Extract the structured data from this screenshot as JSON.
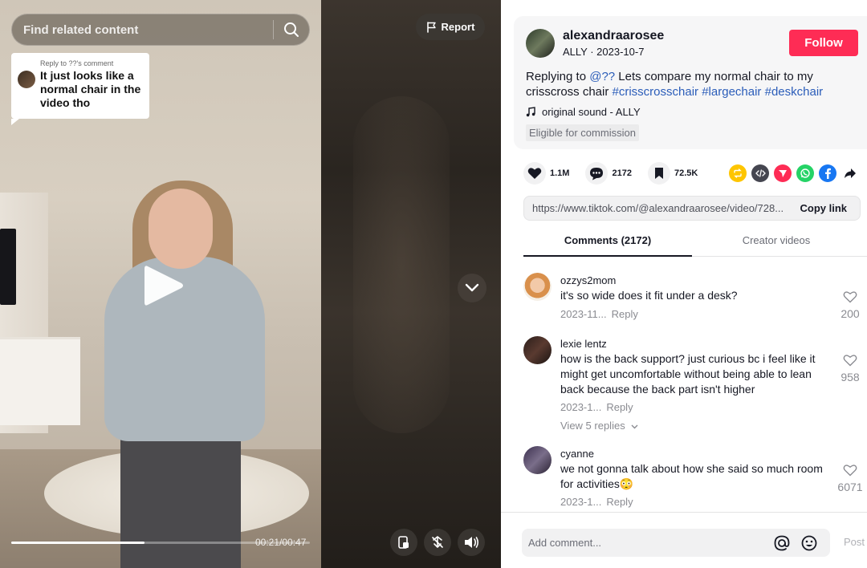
{
  "video": {
    "search_placeholder": "Find related content",
    "reply_header": "Reply to ??'s comment",
    "reply_text": "It just looks like a normal chair in the video tho",
    "report_label": "Report",
    "time": "00:21/00:47",
    "progress": 0.447
  },
  "post": {
    "author": "alexandraarosee",
    "nickname_date": "ALLY · 2023-10-7",
    "follow_label": "Follow",
    "desc_prefix": "Replying to ",
    "mention": "@??",
    "desc_text": " Lets compare my normal chair to my crisscross chair ",
    "hashtags": [
      "#crisscrosschair",
      "#largechair",
      "#deskchair"
    ],
    "sound": "original sound - ALLY",
    "commission": "Eligible for commission"
  },
  "stats": {
    "likes": "1.1M",
    "comments": "2172",
    "saves": "72.5K"
  },
  "share_icons": [
    "repost-icon",
    "embed-icon",
    "send-icon",
    "whatsapp-icon",
    "facebook-icon",
    "share-arrow-icon"
  ],
  "colors": {
    "brand": "#fe2c55",
    "link": "#2b5db9"
  },
  "link": {
    "url": "https://www.tiktok.com/@alexandraarosee/video/728...",
    "copy_label": "Copy link"
  },
  "tabs": [
    {
      "label": "Comments (2172)",
      "active": true
    },
    {
      "label": "Creator videos",
      "active": false
    }
  ],
  "comments": [
    {
      "user": "ozzys2mom",
      "text": "it's so wide does it fit under a desk?",
      "date": "2023-11...",
      "reply": "Reply",
      "likes": "200"
    },
    {
      "user": "lexie lentz",
      "text": "how is the back support? just curious bc i feel like it might get uncomfortable without being able to lean back because the back part isn't higher",
      "date": "2023-1...",
      "reply": "Reply",
      "likes": "958",
      "view_replies": "View 5 replies"
    },
    {
      "user": "cyanne",
      "text": "we not gonna talk about how she said so much room for activities😳",
      "date": "2023-1...",
      "reply": "Reply",
      "likes": "6071"
    }
  ],
  "comment_bar": {
    "placeholder": "Add comment...",
    "post_label": "Post"
  }
}
